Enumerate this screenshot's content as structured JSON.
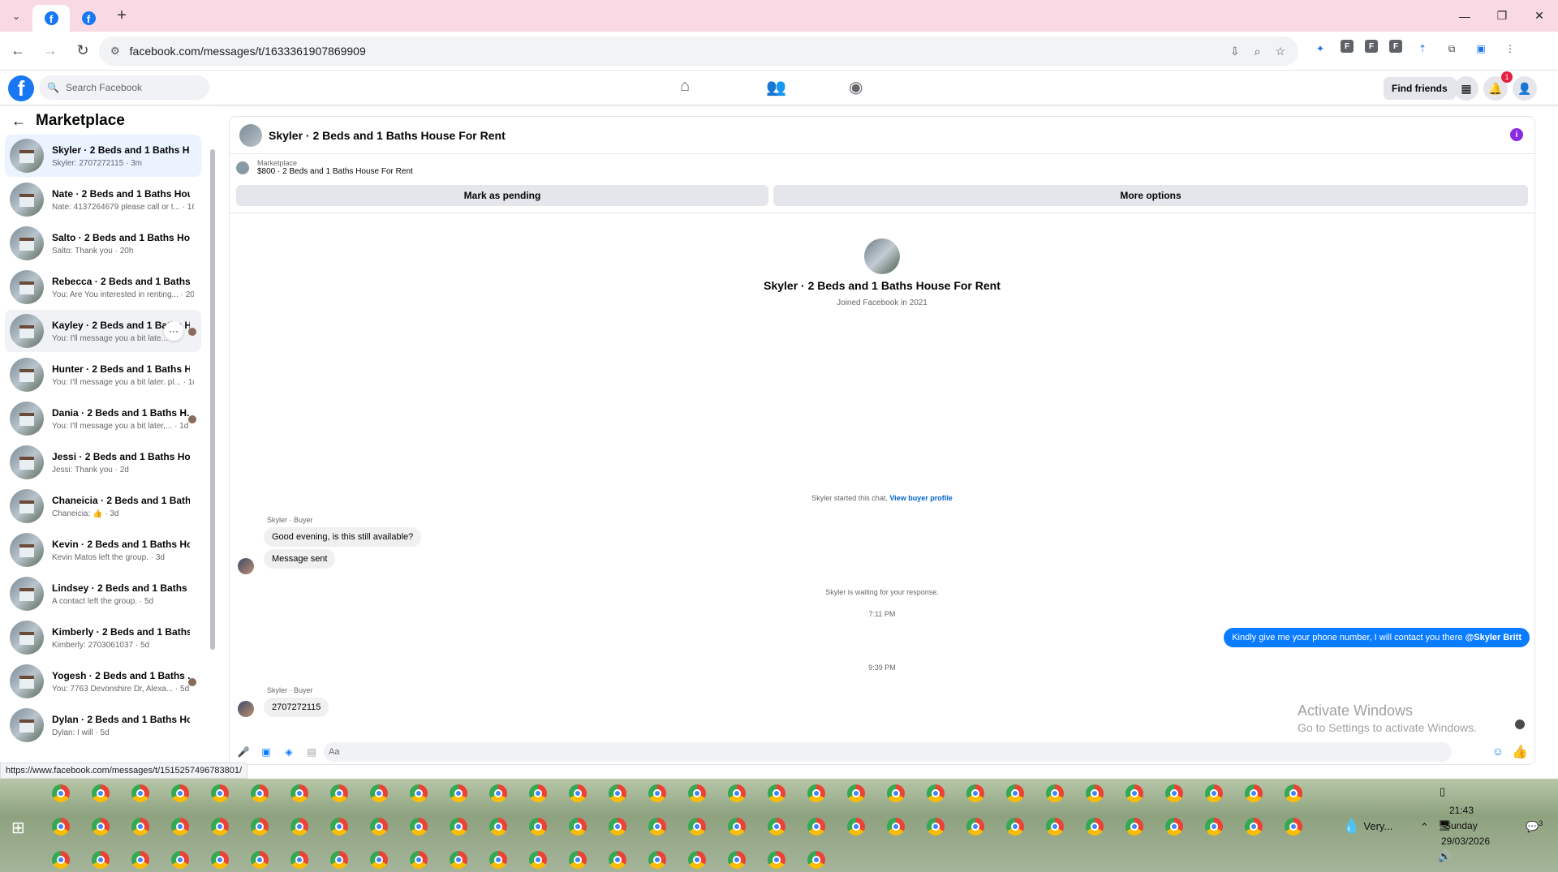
{
  "browser": {
    "tab_dropdown_icon": "chevron-down-icon",
    "new_tab_label": "+",
    "url": "facebook.com/messages/t/1633361907869909",
    "status_url": "https://www.facebook.com/messages/t/1515257496783801/"
  },
  "facebook": {
    "logo_letter": "f",
    "search_placeholder": "Search Facebook",
    "find_friends": "Find friends",
    "notification_count": "1"
  },
  "sidebar": {
    "title": "Marketplace",
    "conversations": [
      {
        "name": "Skyler · 2 Beds and 1 Baths Hous...",
        "preview": "Skyler: 2707272115 · 3m"
      },
      {
        "name": "Nate · 2 Beds and 1 Baths Hous...",
        "preview": "Nate: 4137264679 please call or t... · 16h"
      },
      {
        "name": "Salto · 2 Beds and 1 Baths House...",
        "preview": "Salto: Thank you · 20h"
      },
      {
        "name": "Rebecca · 2 Beds and 1 Baths H...",
        "preview": "You: Are You interested in renting... · 20h"
      },
      {
        "name": "Kayley · 2 Beds and 1 Baths H...",
        "preview": "You: I'll message you a bit late..."
      },
      {
        "name": "Hunter · 2 Beds and 1 Baths Ho...",
        "preview": "You: I'll message you a bit later. pl... · 1d"
      },
      {
        "name": "Dania · 2 Beds and 1 Baths H...",
        "preview": "You: I'll message you a bit later,... · 1d"
      },
      {
        "name": "Jessi · 2 Beds and 1 Baths Hous...",
        "preview": "Jessi: Thank you · 2d"
      },
      {
        "name": "Chaneicia · 2 Beds and 1 Baths ...",
        "preview": "Chaneicia: 👍 · 3d"
      },
      {
        "name": "Kevin · 2 Beds and 1 Baths Hous...",
        "preview": "Kevin Matos left the group. · 3d"
      },
      {
        "name": "Lindsey · 2 Beds and 1 Baths Ho...",
        "preview": "A contact left the group. · 5d"
      },
      {
        "name": "Kimberly · 2 Beds and 1 Baths H...",
        "preview": "Kimberly: 2703061037 · 5d"
      },
      {
        "name": "Yogesh · 2 Beds and 1 Baths ...",
        "preview": "You: 7763 Devonshire Dr, Alexa... · 5d"
      },
      {
        "name": "Dylan · 2 Beds and 1 Baths Hou...",
        "preview": "Dylan: I will · 5d"
      }
    ]
  },
  "chat": {
    "title": "Skyler · 2 Beds and 1 Baths House For Rent",
    "marketplace_label": "Marketplace",
    "listing": "$800 · 2 Beds and 1 Baths House For Rent",
    "mark_pending": "Mark as pending",
    "more_options": "More options",
    "profile_name": "Skyler · 2 Beds and 1 Baths House For Rent",
    "profile_joined": "Joined Facebook in 2021",
    "started_text": "Skyler started this chat.",
    "view_buyer": "View buyer profile",
    "sender_label": "Skyler · Buyer",
    "msg1": "Good evening, is this still available?",
    "msg2": "Message sent",
    "waiting": "Skyler is waiting for your response.",
    "time1": "7:11 PM",
    "out_msg": "Kindly give me your phone number, I will contact you there",
    "out_mention": "@Skyler Britt",
    "time2": "9:39 PM",
    "sender_label2": "Skyler · Buyer",
    "msg3": "2707272115",
    "composer_placeholder": "Aa"
  },
  "watermark": {
    "line1": "Activate Windows",
    "line2": "Go to Settings to activate Windows."
  },
  "taskbar": {
    "weather": "Very...",
    "time": "21:43",
    "day": "Sunday",
    "date": "29/03/2026",
    "action_center_count": "3"
  }
}
